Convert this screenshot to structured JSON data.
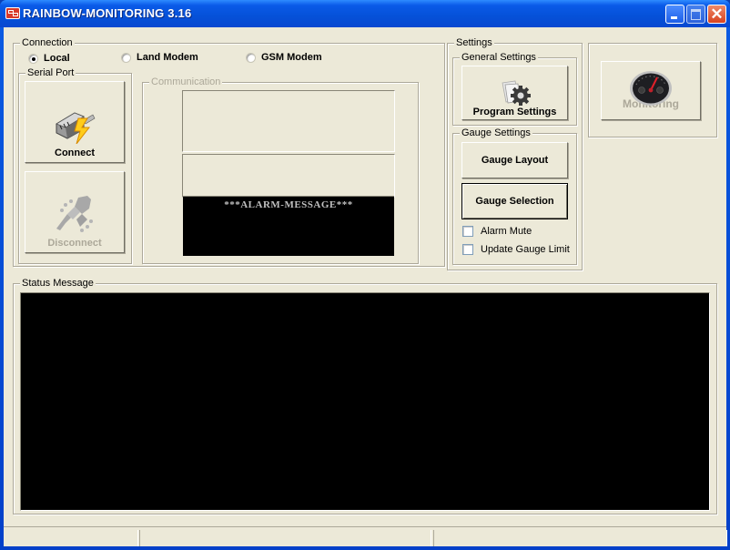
{
  "window": {
    "title": "RAINBOW-MONITORING 3.16",
    "controls": [
      "minimize-icon",
      "maximize-icon",
      "close-icon"
    ],
    "close_glyph": "✕"
  },
  "connection": {
    "group_label": "Connection",
    "options": [
      {
        "label": "Local",
        "selected": true
      },
      {
        "label": "Land Modem",
        "selected": false
      },
      {
        "label": "GSM Modem",
        "selected": false
      }
    ],
    "serial_port": {
      "group_label": "Serial Port",
      "connect_label": "Connect",
      "connect_icon": "network-plug-lightning-icon",
      "disconnect_label": "Disconnect",
      "disconnect_enabled": false,
      "disconnect_icon": "unplugged-icon"
    },
    "communication": {
      "group_label": "Communication",
      "enabled": false,
      "alarm_text": "***ALARM-MESSAGE***"
    }
  },
  "settings": {
    "group_label": "Settings",
    "general": {
      "group_label": "General Settings",
      "program_settings_label": "Program Settings",
      "program_settings_icon": "documents-gear-icon"
    },
    "gauge": {
      "group_label": "Gauge Settings",
      "layout_label": "Gauge Layout",
      "selection_label": "Gauge Selection",
      "alarm_mute_label": "Alarm Mute",
      "alarm_mute_checked": false,
      "update_limit_label": "Update Gauge Limit",
      "update_limit_checked": false
    }
  },
  "monitoring": {
    "label": "Monitoring",
    "enabled": false,
    "icon": "speedometer-icon"
  },
  "status": {
    "group_label": "Status Message",
    "panes": [
      "",
      "",
      ""
    ]
  },
  "colors": {
    "titlebar": "#0551d8",
    "face": "#ece9d8",
    "screen": "#000000",
    "disabled_text": "#aca899"
  }
}
